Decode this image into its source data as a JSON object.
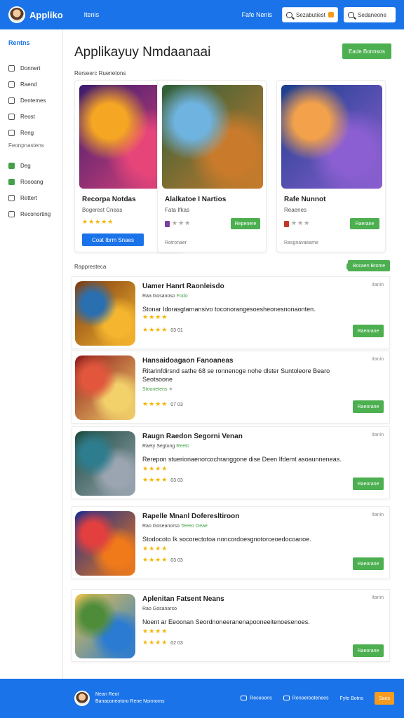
{
  "header": {
    "app_name": "Applikо",
    "nav_link": "Itenis",
    "right_link": "Fafe Nenis",
    "search_placeholder": "Sezabutiest",
    "signin_label": "Sedaneone"
  },
  "sidebar": {
    "title": "Rentns",
    "items": [
      {
        "label": "Donnert",
        "icon": "home-icon"
      },
      {
        "label": "Raend",
        "icon": "tag-icon"
      },
      {
        "label": "Dentemes",
        "icon": "calendar-icon"
      },
      {
        "label": "Reost",
        "icon": "doc-icon"
      },
      {
        "label": "Reng",
        "icon": "list-icon"
      }
    ],
    "section_label": "Feonpnastens",
    "items2": [
      {
        "label": "Deg",
        "icon": "chat-icon"
      },
      {
        "label": "Roooang",
        "icon": "grid-icon"
      },
      {
        "label": "Rettert",
        "icon": "info-icon"
      },
      {
        "label": "Reconorting",
        "icon": "settings-icon"
      }
    ]
  },
  "main": {
    "title": "Applikayuy Nmdaanaai",
    "cta_label": "Eade Bonnsos",
    "featured_label": "Rerseerc Ruenetons",
    "featured": [
      {
        "name": "Recorpa Notdas",
        "sub": "Bogerest Cneas",
        "stars": "★★★★★",
        "button": "Coat Ibrm Snaes",
        "button_style": "blue",
        "colors": [
          "#3b1b6e",
          "#e6457a",
          "#f5a623"
        ]
      },
      {
        "name": "Alalkatoe I Nartios",
        "sub": "Fata Ifkas",
        "stars": "★★★",
        "button": "Repenere",
        "button_style": "green",
        "footer": "Rotronaer",
        "colors": [
          "#2c5e3a",
          "#c97b2b",
          "#6fb3e0"
        ]
      },
      {
        "name": "Rafe Nunnot",
        "sub": "Reaenes",
        "stars": "★★★",
        "button": "Raerane",
        "button_style": "green",
        "footer": "Rasgnavaeame",
        "colors": [
          "#1c3f8c",
          "#8b5fd1",
          "#f3a24b"
        ]
      }
    ],
    "recommended_label": "Rappresteca",
    "recommended_button": "Bocaen Brome",
    "rows": [
      {
        "title": "Uamer Hanrt Raonleisdo",
        "meta": "Raa Gosanoso",
        "meta_green": "Fodo",
        "desc": "Stonar Idorasgtarnansivo toconorangesoesheonesnonaonten.",
        "stars1": "★★★★",
        "stars2": "★★★★",
        "count": "03 01",
        "right": "Itanin",
        "button": "Raeorane",
        "colors": [
          "#7b3a12",
          "#f5b52e",
          "#2a6fb0"
        ]
      },
      {
        "title": "Hansaidoagaon Fanoaneas",
        "meta": "",
        "meta_green": "Stoonetens",
        "desc": "Ritarinfdirsnd sathe 68 se ronnenoge nohe dlster Suntoleore Bearo Seotsoone",
        "stars1": "",
        "stars2": "★★★★",
        "count": "07 03",
        "right": "Itanin",
        "button": "Raeorane",
        "colors": [
          "#8e1b1b",
          "#f2d16b",
          "#e2563d"
        ]
      },
      {
        "title": "Raugn Raedon Segorni Venan",
        "meta": "Raety Segtong",
        "meta_green": "Reeto",
        "desc": "Rerepon stuerionaenorcochranggone dise Deen Ifdemt asoaunneneas.",
        "stars1": "★★★★",
        "stars2": "★★★★",
        "count": "03 03",
        "right": "Itanin",
        "button": "Raeorane",
        "colors": [
          "#1a4a3e",
          "#9aa5b1",
          "#2e7d8f"
        ]
      },
      {
        "title": "Rapelle Mnanl Doferesltiroon",
        "meta": "Rao Goseanorso",
        "meta_green": "Teeeo Oeae",
        "desc": "Stodocoto Ik socorectotoa noncordoesgnotorceoedocoanoe.",
        "stars1": "★★★★",
        "stars2": "★★★★",
        "count": "03 03",
        "right": "Itanin",
        "button": "Raeorane",
        "colors": [
          "#1b2e8c",
          "#f07a1a",
          "#e43f3f"
        ]
      },
      {
        "title": "Aplenitan Fatsent Neans",
        "meta": "Rao Gosanarso",
        "meta_green": "",
        "desc": "Noent ar Eeoonan Seordnoneeranenapooneeitenoesenoes.",
        "stars1": "★★★★",
        "stars2": "★★★★",
        "count": "02 03",
        "right": "Itanin",
        "button": "Raeorane",
        "colors": [
          "#e8c14a",
          "#2a7bd1",
          "#4e8c3a"
        ]
      }
    ]
  },
  "footer": {
    "name": "Nean Reot",
    "sub": "Banaconeotoro Rene Nonnorns",
    "link1": "Recooons",
    "link2": "Renoerootenees",
    "link3": "Fyfe Botns",
    "button": "Saes"
  }
}
